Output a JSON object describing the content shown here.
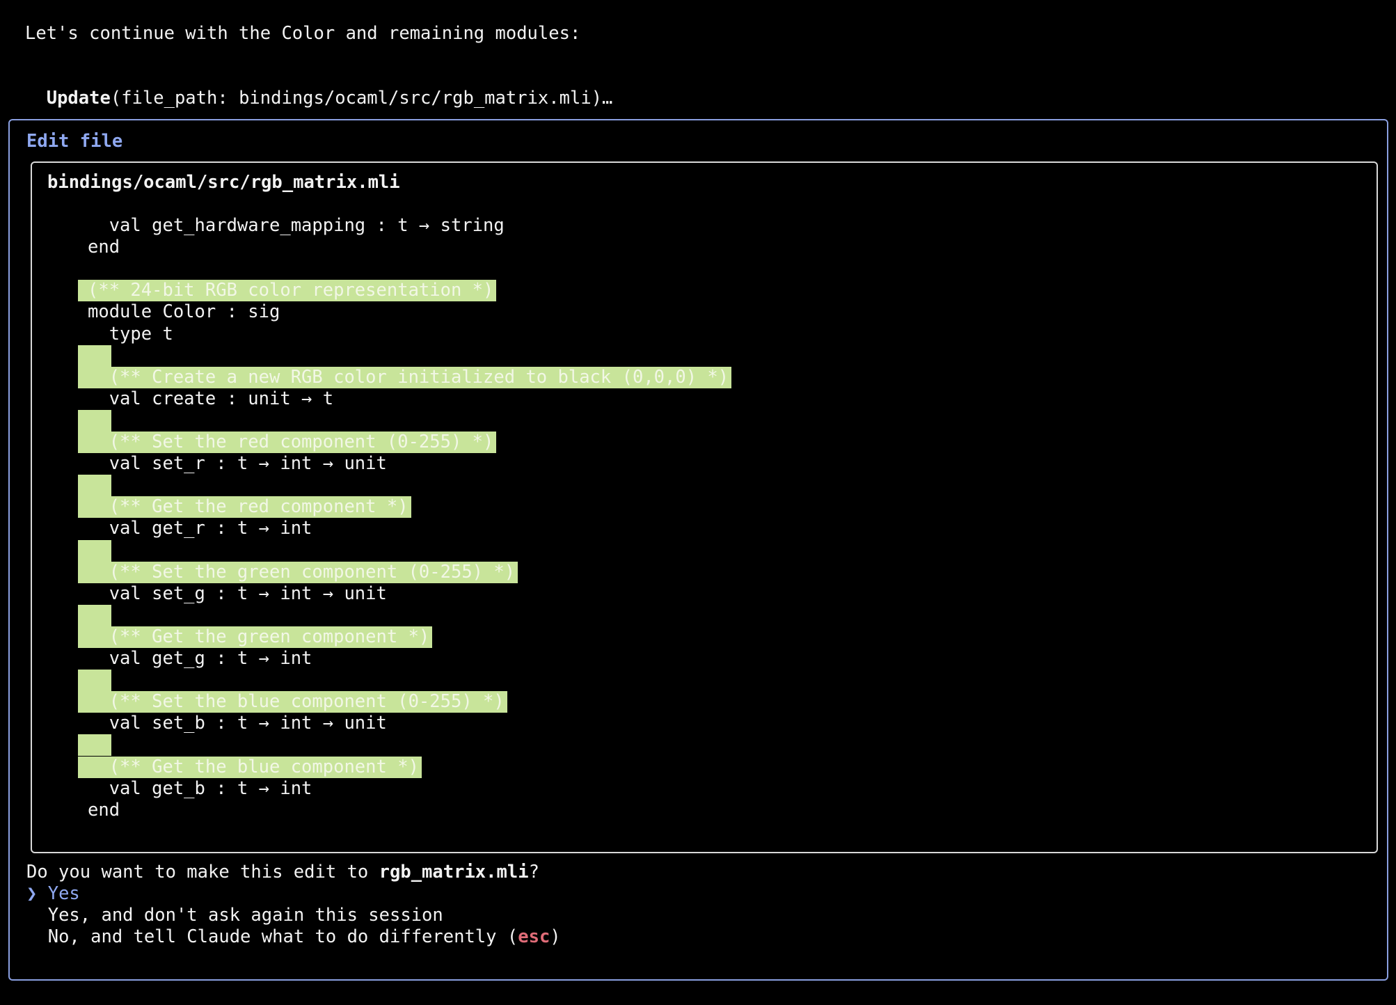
{
  "intro": {
    "message": "Let's continue with the Color and remaining modules:",
    "tool_name": "Update",
    "tool_args": "(file_path: bindings/ocaml/src/rgb_matrix.mli)…"
  },
  "edit_panel": {
    "title": "Edit file",
    "file_path": "bindings/ocaml/src/rgb_matrix.mli",
    "lines": [
      {
        "text": "  val get_hardware_mapping : t → string",
        "added": false
      },
      {
        "text": "end",
        "added": false
      },
      {
        "text": "",
        "added": false
      },
      {
        "text": "(** 24-bit RGB color representation *)",
        "added": true
      },
      {
        "text": "module Color : sig",
        "added": false
      },
      {
        "text": "  type t",
        "added": false
      },
      {
        "text": "",
        "added": true
      },
      {
        "text": "  (** Create a new RGB color initialized to black (0,0,0) *)",
        "added": true
      },
      {
        "text": "  val create : unit → t",
        "added": false
      },
      {
        "text": "",
        "added": true
      },
      {
        "text": "  (** Set the red component (0-255) *)",
        "added": true
      },
      {
        "text": "  val set_r : t → int → unit",
        "added": false
      },
      {
        "text": "",
        "added": true
      },
      {
        "text": "  (** Get the red component *)",
        "added": true
      },
      {
        "text": "  val get_r : t → int",
        "added": false
      },
      {
        "text": "",
        "added": true
      },
      {
        "text": "  (** Set the green component (0-255) *)",
        "added": true
      },
      {
        "text": "  val set_g : t → int → unit",
        "added": false
      },
      {
        "text": "",
        "added": true
      },
      {
        "text": "  (** Get the green component *)",
        "added": true
      },
      {
        "text": "  val get_g : t → int",
        "added": false
      },
      {
        "text": "",
        "added": true
      },
      {
        "text": "  (** Set the blue component (0-255) *)",
        "added": true
      },
      {
        "text": "  val set_b : t → int → unit",
        "added": false
      },
      {
        "text": "",
        "added": true
      },
      {
        "text": "  (** Get the blue component *)",
        "added": true
      },
      {
        "text": "  val get_b : t → int",
        "added": false
      },
      {
        "text": "end",
        "added": false
      }
    ]
  },
  "confirm": {
    "question_prefix": "Do you want to make this edit to ",
    "question_file": "rgb_matrix.mli",
    "question_suffix": "?",
    "pointer": "❯",
    "options": [
      {
        "label": "Yes"
      },
      {
        "label": "Yes, and don't ask again this session"
      },
      {
        "label": "No, and tell Claude what to do differently ("
      }
    ],
    "esc_label": "esc",
    "esc_suffix": ")"
  },
  "colors": {
    "accent": "#8fa8f0",
    "added_bg": "#c8e49a",
    "esc": "#e06c78"
  }
}
